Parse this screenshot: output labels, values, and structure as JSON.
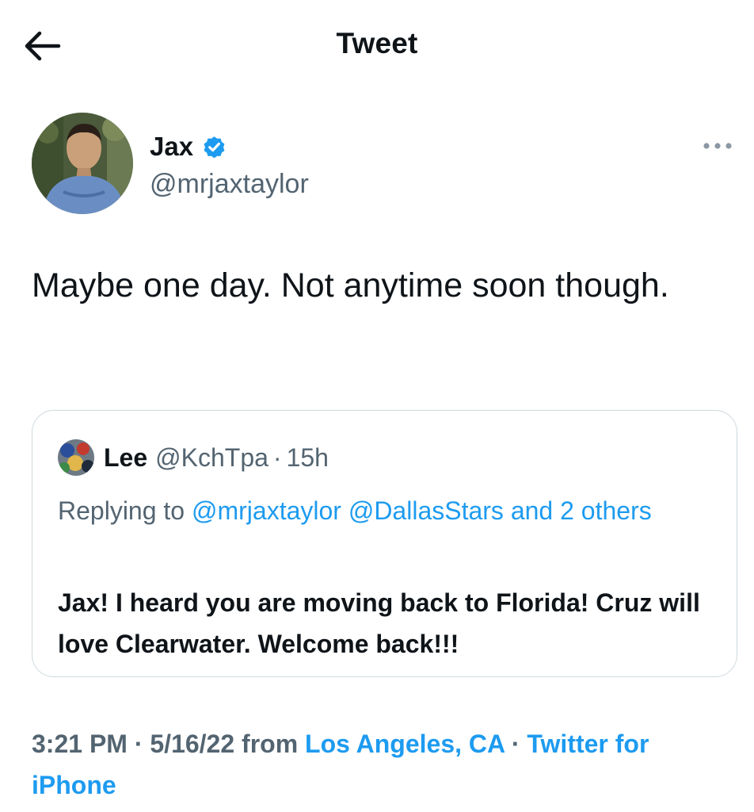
{
  "header": {
    "title": "Tweet",
    "back_icon": "arrow-left-icon"
  },
  "author": {
    "name": "Jax",
    "handle": "@mrjaxtaylor",
    "verified": true,
    "verified_color": "#1d9bf0"
  },
  "tweet": {
    "text": "Maybe one day. Not anytime soon though."
  },
  "quoted": {
    "name": "Lee",
    "handle": "@KchTpa",
    "separator": "·",
    "time": "15h",
    "replying_prefix": "Replying to",
    "mention_1": "@mrjaxtaylor",
    "mention_2": "@DallasStars",
    "and_text": "and",
    "others_text": "2 others",
    "text": "Jax! I heard you are moving back to Florida! Cruz will love Clearwater. Welcome back!!!"
  },
  "meta": {
    "time": "3:21 PM",
    "separator": "·",
    "date": "5/16/22",
    "from_text": "from",
    "location": "Los Angeles, CA",
    "client": "Twitter for iPhone"
  },
  "colors": {
    "link": "#1d9bf0",
    "secondary_text": "#536471",
    "border": "#cfd9de"
  }
}
